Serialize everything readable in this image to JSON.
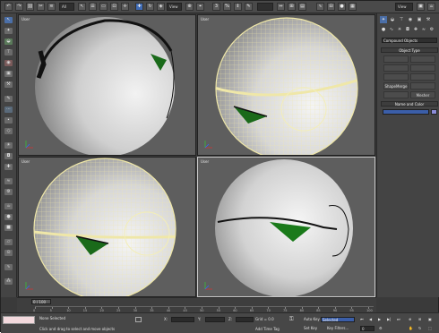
{
  "toolbar": {
    "selection_filter": "All",
    "reference_coord": "View",
    "snap_value": "3",
    "named_set": "",
    "icons": [
      "undo-icon",
      "redo-icon",
      "link-icon",
      "unlink-icon",
      "bind-icon",
      "filter-icon",
      "select-icon",
      "select-by-name-icon",
      "region-icon",
      "window-icon",
      "move-icon",
      "rotate-icon",
      "scale-icon",
      "ref-coord-icon",
      "pivot-icon",
      "snap-icon",
      "angle-snap-icon",
      "percent-snap-icon",
      "spinner-snap-icon",
      "edit-named-icon",
      "named-sets-icon",
      "mirror-icon",
      "align-icon",
      "layers-icon",
      "curve-editor-icon",
      "schematic-icon",
      "material-editor-icon",
      "render-setup-icon",
      "render-frame-icon",
      "render-icon"
    ]
  },
  "viewports": [
    {
      "label": "User",
      "active": false
    },
    {
      "label": "User",
      "active": false
    },
    {
      "label": "User",
      "active": false
    },
    {
      "label": "User",
      "active": true
    }
  ],
  "command_panel": {
    "category": "Compound Objects",
    "object_type_title": "Object Type",
    "name_color_title": "Name and Color",
    "buttons": [
      "",
      "",
      "",
      "",
      "",
      "",
      "ShapeMerge",
      "",
      "",
      "Mesher"
    ],
    "name_value": ""
  },
  "timeline": {
    "frame_label": "0 / 100",
    "ticks": [
      "0",
      "5",
      "10",
      "15",
      "20",
      "25",
      "30",
      "35",
      "40",
      "45",
      "50",
      "55",
      "60",
      "65",
      "70",
      "75",
      "80",
      "85",
      "90",
      "95",
      "100"
    ]
  },
  "status": {
    "selection": "None Selected",
    "prompt": "Click and drag to select and move objects",
    "grid": "Grid = 0.0",
    "add_time_tag": "Add Time Tag",
    "auto_key": "Auto Key",
    "set_key": "Set Key",
    "key_mode": "Selected",
    "key_filters": "Key Filters...",
    "x_label": "X:",
    "y_label": "Y:",
    "z_label": "Z:",
    "current_frame": "0"
  },
  "colors": {
    "wire": "#f5efb0",
    "highlight": "#e9df9a",
    "green": "#1a7a1a",
    "selected_field": "#3b5ea8"
  }
}
